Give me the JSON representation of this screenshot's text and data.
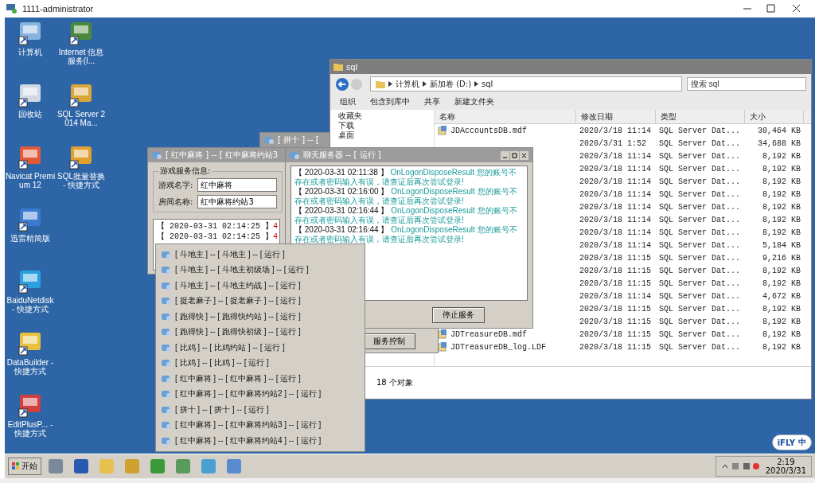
{
  "remote_window": {
    "title": "1111-administrator"
  },
  "desktop_icons": [
    {
      "label": "计算机"
    },
    {
      "label": "Internet 信息服务(I..."
    },
    {
      "label": "回收站"
    },
    {
      "label": "SQL Server 2014 Ma..."
    },
    {
      "label": "Navicat Premium 12"
    },
    {
      "label": "SQL批量替换 - 快捷方式"
    },
    {
      "label": "迅雷精简版"
    },
    {
      "label": "BaiduNetdisk - 快捷方式"
    },
    {
      "label": "DataBuilder - 快捷方式"
    },
    {
      "label": "EditPlusP... - 快捷方式"
    }
  ],
  "explorer": {
    "title": "sql",
    "breadcrumb": [
      "计算机",
      "新加卷 (D:)",
      "sql"
    ],
    "search": {
      "placeholder": "搜索 sql"
    },
    "toolbar": [
      "组织",
      "包含到库中",
      "共享",
      "新建文件夹"
    ],
    "nav": [
      {
        "label": "收藏夹"
      },
      {
        "label": "下载"
      },
      {
        "label": "桌面"
      }
    ],
    "columns": [
      "名称",
      "修改日期",
      "类型",
      "大小"
    ],
    "rows": [
      {
        "name": "JDAccountsDB.mdf",
        "date": "2020/3/18 11:14",
        "type": "SQL Server Dat...",
        "size": "30,464 KB"
      },
      {
        "date": "2020/3/31 1:52",
        "type": "SQL Server Dat...",
        "size": "34,688 KB"
      },
      {
        "date": "2020/3/18 11:14",
        "type": "SQL Server Dat...",
        "size": "8,192 KB"
      },
      {
        "date": "2020/3/18 11:14",
        "type": "SQL Server Dat...",
        "size": "8,192 KB"
      },
      {
        "date": "2020/3/18 11:14",
        "type": "SQL Server Dat...",
        "size": "8,192 KB"
      },
      {
        "date": "2020/3/18 11:14",
        "type": "SQL Server Dat...",
        "size": "8,192 KB"
      },
      {
        "date": "2020/3/18 11:14",
        "type": "SQL Server Dat...",
        "size": "8,192 KB"
      },
      {
        "date": "2020/3/18 11:14",
        "type": "SQL Server Dat...",
        "size": "8,192 KB"
      },
      {
        "date": "2020/3/18 11:14",
        "type": "SQL Server Dat...",
        "size": "8,192 KB"
      },
      {
        "date": "2020/3/18 11:14",
        "type": "SQL Server Dat...",
        "size": "5,184 KB"
      },
      {
        "date": "2020/3/18 11:15",
        "type": "SQL Server Dat...",
        "size": "9,216 KB"
      },
      {
        "date": "2020/3/18 11:15",
        "type": "SQL Server Dat...",
        "size": "8,192 KB"
      },
      {
        "date": "2020/3/18 11:15",
        "type": "SQL Server Dat...",
        "size": "8,192 KB"
      },
      {
        "date": "2020/3/18 11:14",
        "type": "SQL Server Dat...",
        "size": "4,672 KB"
      },
      {
        "date": "2020/3/18 11:15",
        "type": "SQL Server Dat...",
        "size": "8,192 KB"
      },
      {
        "date": "2020/3/18 11:15",
        "type": "SQL Server Dat...",
        "size": "8,192 KB"
      },
      {
        "name": "JDTreasureDB.mdf",
        "date": "2020/3/18 11:15",
        "type": "SQL Server Dat...",
        "size": "8,192 KB"
      },
      {
        "name": "JDTreasureDB_log.LDF",
        "date": "2020/3/18 11:15",
        "type": "SQL Server Dat...",
        "size": "8,192 KB"
      }
    ],
    "status": "18 个对象"
  },
  "back_window": {
    "title": "[ 拼十 ] -- ["
  },
  "control_window": {
    "button": "服务控制"
  },
  "game_window": {
    "title": "[ 红中麻将 ] -- [ 红中麻将约站3",
    "group": "游戏服务信息:",
    "fields": [
      {
        "label": "游戏名字:",
        "value": "红中麻将"
      },
      {
        "label": "房间名称:",
        "value": "红中麻将约站3"
      }
    ],
    "log": [
      {
        "time": "【 2020-03-31 02:14:25 】",
        "code": "4"
      },
      {
        "time": "【 2020-03-31 02:14:25 】",
        "code": "4"
      }
    ]
  },
  "chat_window": {
    "title": "聊天服务器 -- [ 运行 ]",
    "log": [
      {
        "time": "【 2020-03-31 02:11:38 】",
        "source": "OnLogonDisposeResult",
        "message": "您的账号不存在或者密码输入有误，请查证后再次尝试登录!"
      },
      {
        "time": "【 2020-03-31 02:16:00 】",
        "source": "OnLogonDisposeResult",
        "message": "您的账号不存在或者密码输入有误，请查证后再次尝试登录!"
      },
      {
        "time": "【 2020-03-31 02:16:44 】",
        "source": "OnLogonDisposeResult",
        "message": "您的账号不存在或者密码输入有误，请查证后再次尝试登录!"
      },
      {
        "time": "【 2020-03-31 02:16:44 】",
        "source": "OnLogonDisposeResult",
        "message": "您的账号不存在或者密码输入有误，请查证后再次尝试登录!"
      }
    ],
    "button": "停止服务"
  },
  "server_menu": [
    "[ 斗地主 ] -- [ 斗地主 ] -- [ 运行 ]",
    "[ 斗地主 ] -- [ 斗地主初级场 ] -- [ 运行 ]",
    "[ 斗地主 ] -- [ 斗地主约战 ] -- [ 运行 ]",
    "[ 捉老麻子 ] -- [ 捉老麻子 ] -- [ 运行 ]",
    "[ 跑得快 ] -- [ 跑得快约站 ] -- [ 运行 ]",
    "[ 跑得快 ] -- [ 跑得快初级 ] -- [ 运行 ]",
    "[ 比鸡 ] -- [ 比鸡约站 ] -- [ 运行 ]",
    "[ 比鸡 ] -- [ 比鸡 ] -- [ 运行 ]",
    "[ 红中麻将 ] -- [ 红中麻将 ] -- [ 运行 ]",
    "[ 红中麻将 ] -- [ 红中麻将约站2 ] -- [ 运行 ]",
    "[ 拼十 ] -- [ 拼十 ] -- [ 运行 ]",
    "[ 红中麻将 ] -- [ 红中麻将约站3 ] -- [ 运行 ]",
    "[ 红中麻将 ] -- [ 红中麻将约站4 ] -- [ 运行 ]"
  ],
  "taskbar": {
    "start": "开始",
    "ime": {
      "brand": "iFLY",
      "mode": "中"
    },
    "time": "2:19",
    "date": "2020/3/31"
  }
}
